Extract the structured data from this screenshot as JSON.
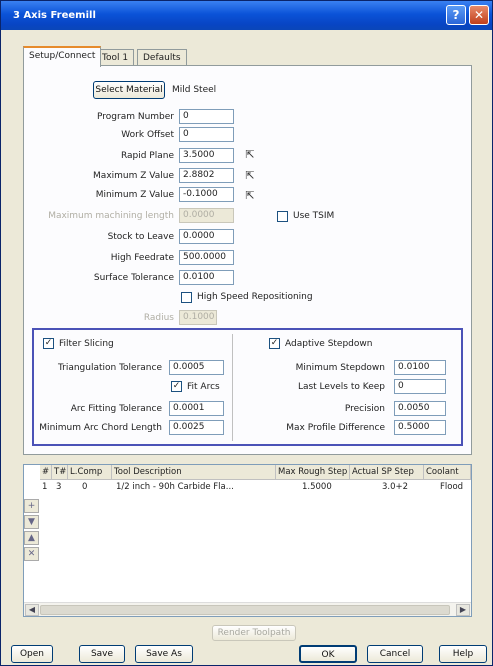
{
  "window": {
    "title": "3 Axis Freemill"
  },
  "tabs": [
    "Setup/Connect",
    "Tool 1",
    "Defaults"
  ],
  "setup": {
    "select_material_label": "Select Material",
    "material_value": "Mild Steel",
    "fields": [
      {
        "label": "Program Number",
        "value": "0"
      },
      {
        "label": "Work Offset",
        "value": "0"
      },
      {
        "label": "Rapid Plane",
        "value": "3.5000"
      },
      {
        "label": "Maximum Z Value",
        "value": "2.8802"
      },
      {
        "label": "Minimum Z Value",
        "value": "-0.1000"
      }
    ],
    "max_machining_length_label": "Maximum machining length",
    "max_machining_length_value": "0.0000",
    "use_tsim_label": "Use TSIM",
    "stock_to_leave_label": "Stock to Leave",
    "stock_to_leave_value": "0.0000",
    "high_feedrate_label": "High Feedrate",
    "high_feedrate_value": "500.0000",
    "surface_tolerance_label": "Surface Tolerance",
    "surface_tolerance_value": "0.0100",
    "high_speed_label": "High Speed Repositioning",
    "radius_label": "Radius",
    "radius_value": "0.1000"
  },
  "group_left": {
    "title": "Filter Slicing",
    "title_checked": true,
    "triangulation_label": "Triangulation Tolerance",
    "triangulation_value": "0.0005",
    "fit_arcs_label": "Fit Arcs",
    "fit_arcs_checked": true,
    "arc_fitting_label": "Arc Fitting Tolerance",
    "arc_fitting_value": "0.0001",
    "min_arc_chord_label": "Minimum Arc Chord Length",
    "min_arc_chord_value": "0.0025"
  },
  "group_right": {
    "title": "Adaptive Stepdown",
    "title_checked": true,
    "min_stepdown_label": "Minimum Stepdown",
    "min_stepdown_value": "0.0100",
    "last_levels_label": "Last Levels to Keep",
    "last_levels_value": "0",
    "precision_label": "Precision",
    "precision_value": "0.0050",
    "max_profile_label": "Max Profile Difference",
    "max_profile_value": "0.5000"
  },
  "grid": {
    "headers": [
      "#",
      "T#",
      "L.Comp",
      "Tool Description",
      "Max Rough Step",
      "Actual SP Step",
      "Coolant"
    ],
    "rows": [
      [
        "1",
        "3",
        "0",
        "1/2 inch - 90h Carbide Fla...",
        "1.5000",
        "3.0+2",
        "Flood"
      ]
    ],
    "side_buttons": [
      "+",
      "▼",
      "▲",
      "✕"
    ]
  },
  "bottom_buttons": {
    "render_label": "Render Toolpath",
    "open_label": "Open",
    "save_label": "Save",
    "save_as_label": "Save As",
    "ok_label": "OK",
    "cancel_label": "Cancel",
    "help_label": "Help"
  },
  "colors": {
    "title_bar": "#0b53d8",
    "group_border": "#4b52b7",
    "tab_accent": "#e68b2c"
  }
}
